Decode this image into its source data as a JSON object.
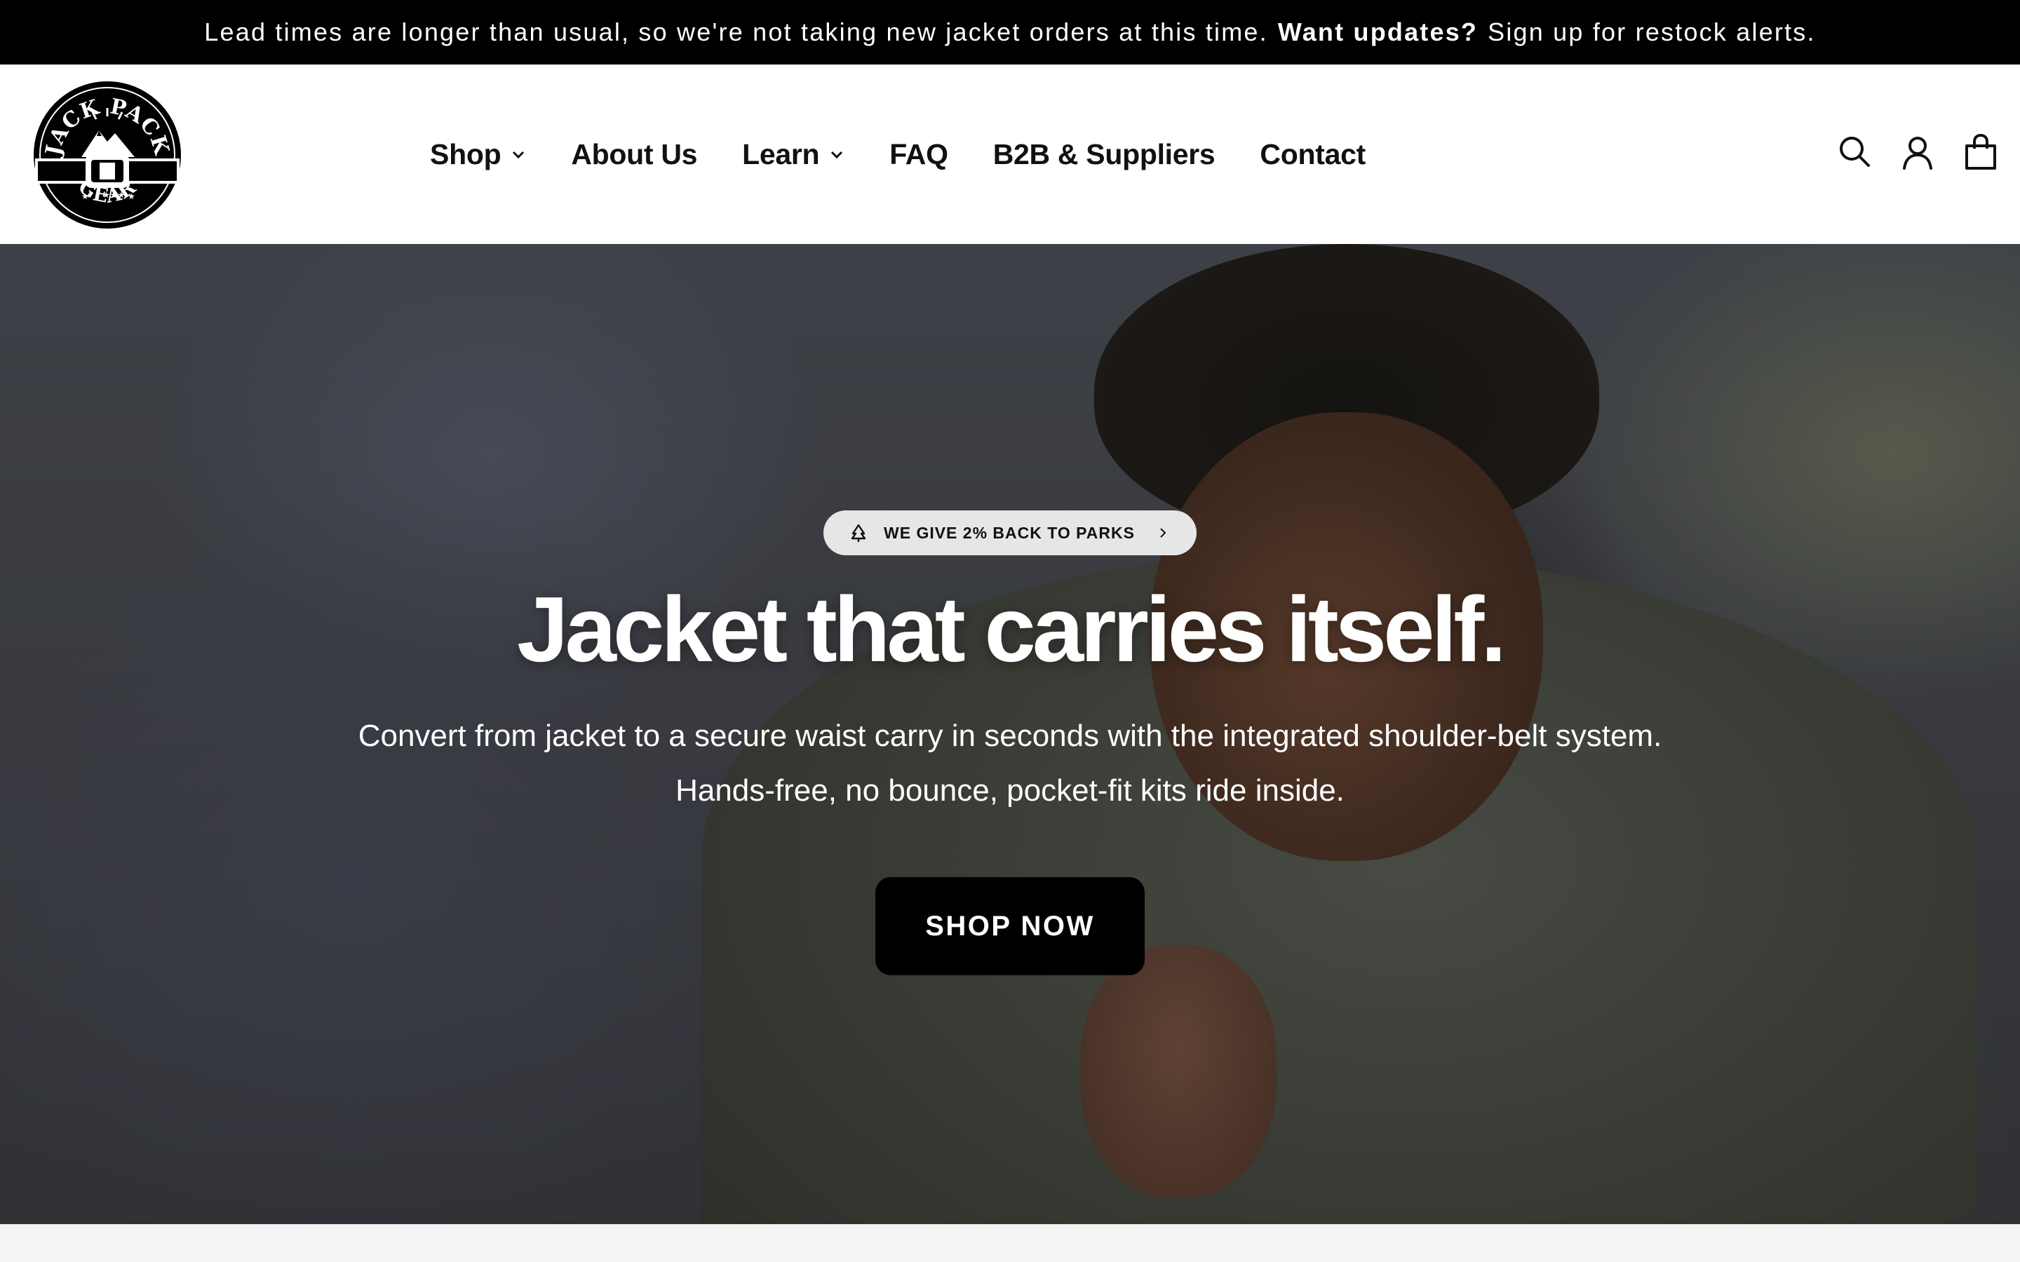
{
  "announcement": {
    "text_before": "Lead times are longer than usual, so we're not taking new jacket orders at this time.",
    "bold": "Want updates?",
    "text_after": "Sign up for restock alerts."
  },
  "header": {
    "logo": {
      "top_text": "JACK PACK",
      "bottom_text": "GEAR"
    },
    "nav": [
      {
        "label": "Shop",
        "dropdown": true
      },
      {
        "label": "About Us",
        "dropdown": false
      },
      {
        "label": "Learn",
        "dropdown": true
      },
      {
        "label": "FAQ",
        "dropdown": false
      },
      {
        "label": "B2B & Suppliers",
        "dropdown": false
      },
      {
        "label": "Contact",
        "dropdown": false
      }
    ],
    "icons": [
      "search-icon",
      "account-icon",
      "cart-icon"
    ]
  },
  "hero": {
    "badge": "WE GIVE 2% BACK TO PARKS",
    "badge_icon": "tree-icon",
    "title": "Jacket that carries itself.",
    "subtitle_line1": "Convert from jacket to a secure waist carry in seconds with the integrated shoulder-belt system.",
    "subtitle_line2": "Hands-free, no bounce, pocket-fit kits ride inside.",
    "cta": "SHOP NOW"
  },
  "colors": {
    "announcement_bg": "#000000",
    "header_bg": "#ffffff",
    "cta_bg": "#000000",
    "badge_bg": "#e6e6e6"
  }
}
